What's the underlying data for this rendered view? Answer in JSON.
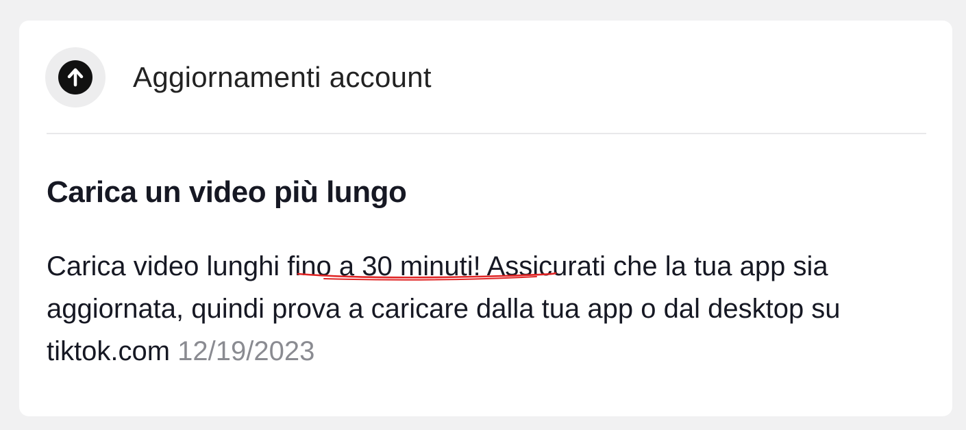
{
  "section": {
    "title": "Aggiornamenti account",
    "icon": "arrow-up-circle-icon"
  },
  "notification": {
    "title": "Carica un video più lungo",
    "body_before": "Carica video lunghi fi",
    "body_highlight": "no a 30 minuti! As",
    "body_after": "sicurati che la tua app sia aggiornata, quindi prova a caricare dalla tua app o dal desktop su tiktok.com",
    "timestamp": "12/19/2023"
  },
  "colors": {
    "annotation_underline": "#e02424",
    "timestamp": "#8a8b91"
  }
}
